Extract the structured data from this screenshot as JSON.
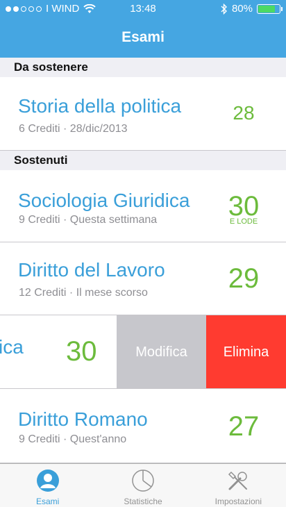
{
  "status_bar": {
    "carrier": "I WIND",
    "time": "13:48",
    "battery": "80%",
    "battery_level": 0.8,
    "signal_dots_filled": 2,
    "signal_dots_total": 5
  },
  "header": {
    "title": "Esami"
  },
  "sections": [
    {
      "title": "Da sostenere"
    },
    {
      "title": "Sostenuti"
    }
  ],
  "exams": [
    {
      "name": "Storia della politica",
      "details": "6 Crediti · 28/dic/2013",
      "grade": "28"
    },
    {
      "name": "Sociologia Giuridica",
      "details": "9 Crediti · Questa settimana",
      "grade": "30",
      "honors": "E LODE"
    },
    {
      "name": "Diritto del Lavoro",
      "details": "12 Crediti · Il mese scorso",
      "grade": "29"
    },
    {
      "name": "ica",
      "grade": "30"
    },
    {
      "name": "Diritto Romano",
      "details": "9 Crediti · Quest'anno",
      "grade": "27"
    }
  ],
  "swipe_actions": {
    "edit": "Modifica",
    "delete": "Elimina"
  },
  "tabs": [
    {
      "label": "Esami",
      "icon": "user-icon",
      "active": true
    },
    {
      "label": "Statistiche",
      "icon": "pie-chart-icon",
      "active": false
    },
    {
      "label": "Impostazioni",
      "icon": "tools-icon",
      "active": false
    }
  ],
  "colors": {
    "nav": "#45a6e2",
    "accent_blue": "#3a9fd9",
    "grade_green": "#6cbb3c",
    "delete_red": "#ff3b30",
    "edit_gray": "#c7c7cc"
  }
}
